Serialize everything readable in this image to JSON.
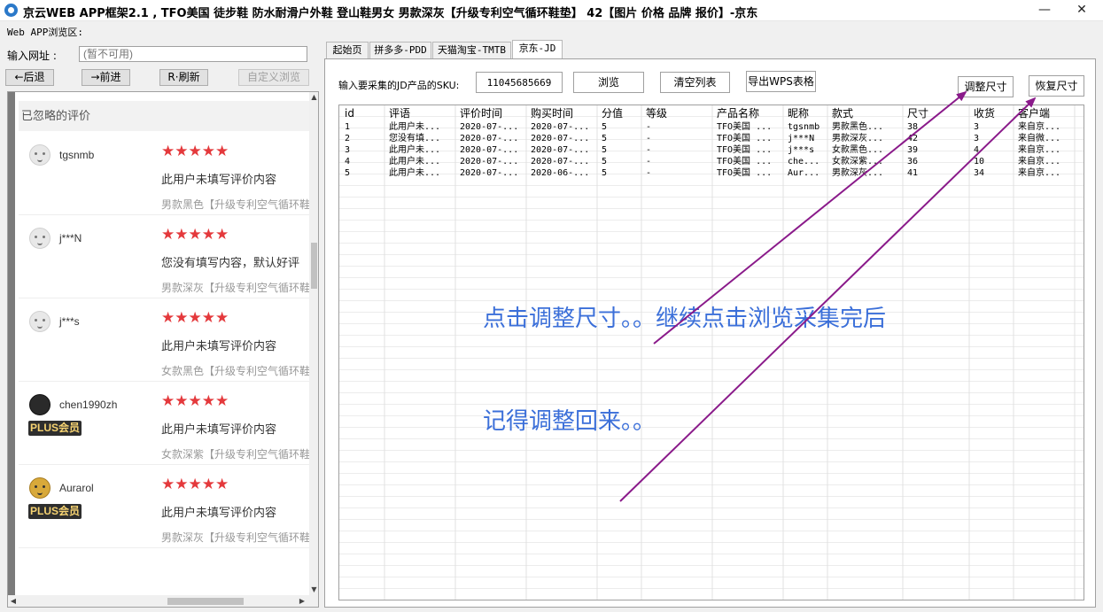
{
  "window": {
    "title": "京云WEB APP框架2.1 , TFO美国 徒步鞋 防水耐滑户外鞋 登山鞋男女 男款深灰【升级专利空气循环鞋垫】 42【图片 价格 品牌 报价】-京东",
    "minimize": "—",
    "close": "✕"
  },
  "browser_area_label": "Web APP浏览区:",
  "url": {
    "label": "输入网址 :",
    "placeholder": "(暂不可用)"
  },
  "nav": {
    "back": "←后退",
    "forward": "→前进",
    "refresh": "R·刷新",
    "custom": "自定义浏览"
  },
  "reviews": {
    "header": "已忽略的评价",
    "items": [
      {
        "nick": "tgsnmb",
        "stars": "★★★★★",
        "text": "此用户未填写评价内容",
        "spec": "男款黑色【升级专利空气循环鞋",
        "plus": ""
      },
      {
        "nick": "j***N",
        "stars": "★★★★★",
        "text": "您没有填写内容，默认好评",
        "spec": "男款深灰【升级专利空气循环鞋",
        "plus": ""
      },
      {
        "nick": "j***s",
        "stars": "★★★★★",
        "text": "此用户未填写评价内容",
        "spec": "女款黑色【升级专利空气循环鞋",
        "plus": ""
      },
      {
        "nick": "chen1990zh",
        "stars": "★★★★★",
        "text": "此用户未填写评价内容",
        "spec": "女款深紫【升级专利空气循环鞋",
        "plus": "PLUS会员"
      },
      {
        "nick": "Aurarol",
        "stars": "★★★★★",
        "text": "此用户未填写评价内容",
        "spec": "男款深灰【升级专利空气循环鞋",
        "plus": "PLUS会员"
      }
    ]
  },
  "tabs": [
    "起始页",
    "拼多多-PDD",
    "天猫淘宝-TMTB",
    "京东-JD"
  ],
  "jd": {
    "sku_label": "输入要采集的JD产品的SKU:",
    "sku_value": "11045685669",
    "browse": "浏览",
    "clear": "清空列表",
    "export": "导出WPS表格",
    "adjust": "调整尺寸",
    "restore": "恢复尺寸"
  },
  "table": {
    "headers": [
      "id",
      "评语",
      "评价时间",
      "购买时间",
      "分值",
      "等级",
      "产品名称",
      "昵称",
      "款式",
      "尺寸",
      "收货",
      "客户端"
    ],
    "rows": [
      [
        "1",
        "此用户未...",
        "2020-07-...",
        "2020-07-...",
        "5",
        "-",
        "TFO美国 ...",
        "tgsnmb",
        "男款黑色...",
        "38",
        "3",
        "来自京..."
      ],
      [
        "2",
        "您没有填...",
        "2020-07-...",
        "2020-07-...",
        "5",
        "-",
        "TFO美国 ...",
        "j***N",
        "男款深灰...",
        "42",
        "3",
        "来自微..."
      ],
      [
        "3",
        "此用户未...",
        "2020-07-...",
        "2020-07-...",
        "5",
        "-",
        "TFO美国 ...",
        "j***s",
        "女款黑色...",
        "39",
        "4",
        "来自京..."
      ],
      [
        "4",
        "此用户未...",
        "2020-07-...",
        "2020-07-...",
        "5",
        "-",
        "TFO美国 ...",
        "che...",
        "女款深紫...",
        "36",
        "10",
        "来自京..."
      ],
      [
        "5",
        "此用户未...",
        "2020-07-...",
        "2020-06-...",
        "5",
        "-",
        "TFO美国 ...",
        "Aur...",
        "男款深灰...",
        "41",
        "34",
        "来自京..."
      ]
    ]
  },
  "annotations": {
    "line1": "点击调整尺寸。。继续点击浏览采集完后",
    "line2": "记得调整回来。。"
  },
  "colors": {
    "arrow": "#8a1a8a",
    "annotation": "#3b6fd9",
    "stars": "#e4393c"
  }
}
